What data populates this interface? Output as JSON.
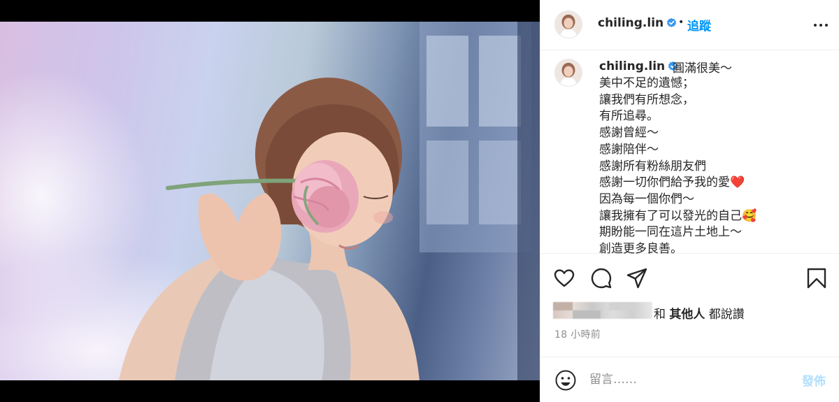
{
  "post": {
    "username": "chiling.lin",
    "follow_label": "追蹤",
    "separator": "•",
    "caption_first": "圓滿很美～",
    "caption_lines": [
      "美中不足的遺憾；",
      "讓我們有所想念，",
      "有所追尋。",
      "感謝曾經～",
      "感謝陪伴～",
      "感謝所有粉絲朋友們",
      "感謝一切你們給予我的愛❤️",
      "因為每一個你們～",
      "讓我擁有了可以發光的自己🥰",
      "期盼能一同在這片土地上～",
      "創造更多良善。"
    ],
    "likes_conjunction": "和 ",
    "likes_others": "其他人",
    "likes_suffix": " 都說讚",
    "timestamp": "18 小時前"
  },
  "comment": {
    "placeholder": "留言……",
    "post_label": "發佈"
  },
  "colors": {
    "accent": "#0095f6",
    "verified": "#3897f0",
    "post_disabled": "#b2dffc",
    "muted": "#8e8e8e"
  },
  "icons": [
    "verified-badge-icon",
    "more-options-icon",
    "heart-icon",
    "comment-icon",
    "share-icon",
    "bookmark-icon",
    "emoji-icon"
  ]
}
